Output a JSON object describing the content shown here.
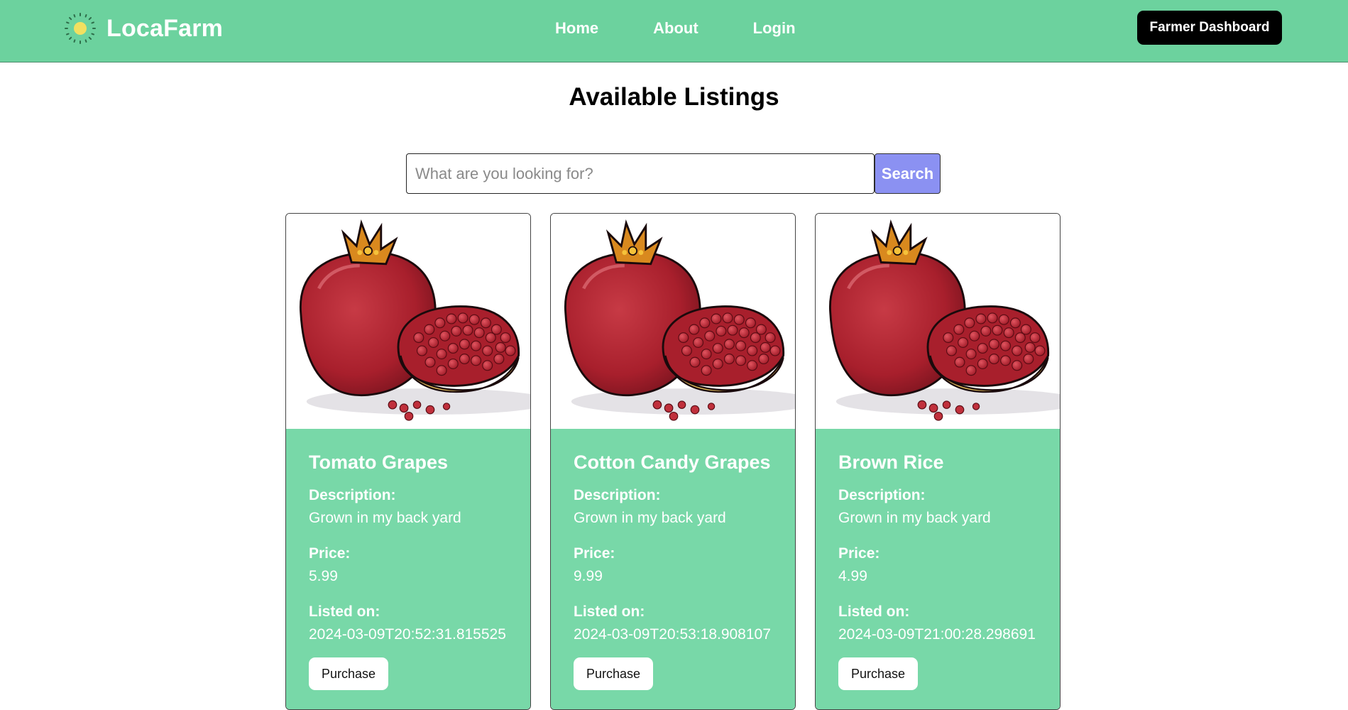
{
  "brand": {
    "name": "LocaFarm",
    "logo_icon": "sun-icon"
  },
  "nav": {
    "links": [
      {
        "label": "Home"
      },
      {
        "label": "About"
      },
      {
        "label": "Login"
      }
    ],
    "dashboard_label": "Farmer Dashboard"
  },
  "page": {
    "title": "Available Listings"
  },
  "search": {
    "placeholder": "What are you looking for?",
    "value": "",
    "button_label": "Search"
  },
  "labels": {
    "description": "Description:",
    "price": "Price:",
    "listed_on": "Listed on:",
    "purchase": "Purchase"
  },
  "listings": [
    {
      "name": "Tomato Grapes",
      "description": "Grown in my back yard",
      "price": "5.99",
      "listed_on": "2024-03-09T20:52:31.815525",
      "image_icon": "pomegranate-image"
    },
    {
      "name": "Cotton Candy Grapes",
      "description": "Grown in my back yard",
      "price": "9.99",
      "listed_on": "2024-03-09T20:53:18.908107",
      "image_icon": "pomegranate-image"
    },
    {
      "name": "Brown Rice",
      "description": "Grown in my back yard",
      "price": "4.99",
      "listed_on": "2024-03-09T21:00:28.298691",
      "image_icon": "pomegranate-image"
    }
  ],
  "colors": {
    "navbar": "#6cd29e",
    "card_body": "#78d8a8",
    "search_button": "#8b91f2",
    "dashboard_button": "#000000"
  }
}
